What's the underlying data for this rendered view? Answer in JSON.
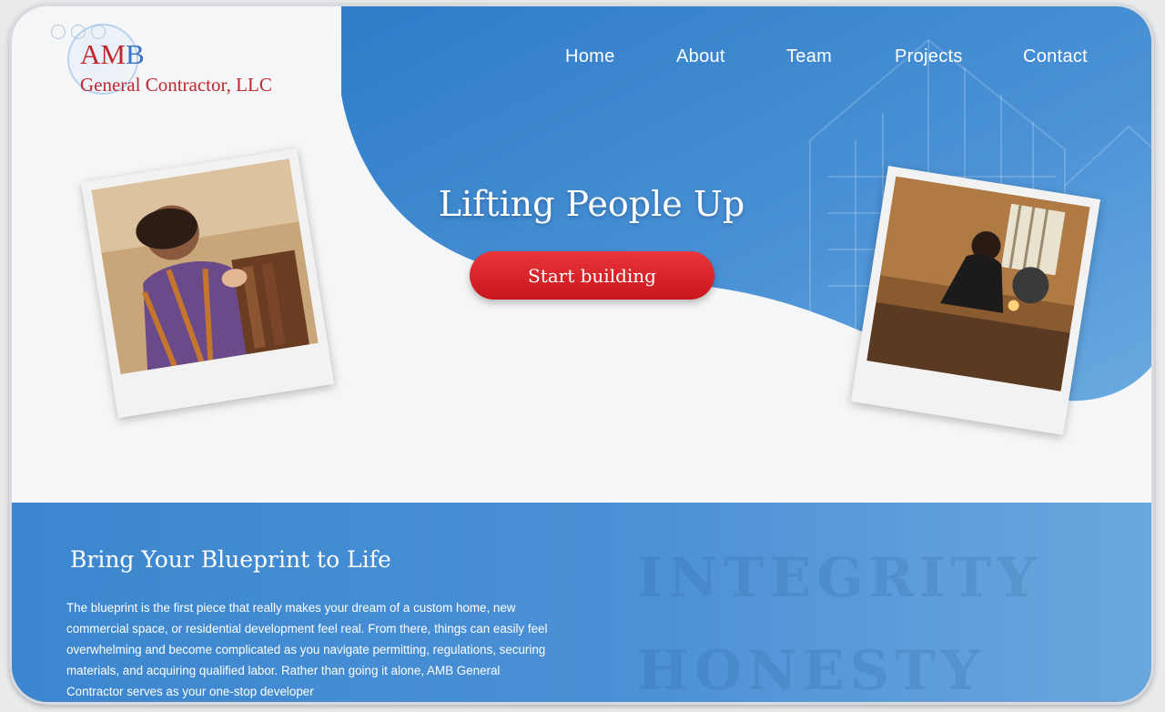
{
  "logo": {
    "mark_a": "AM",
    "mark_b": "B",
    "subtitle": "General Contractor, LLC"
  },
  "nav": {
    "items": [
      "Home",
      "About",
      "Team",
      "Projects",
      "Contact"
    ]
  },
  "hero": {
    "title": "Lifting People Up",
    "cta_label": "Start building"
  },
  "section": {
    "title": "Bring Your Blueprint to Life",
    "body": "The blueprint is the first piece that really makes your dream of a custom home, new commercial space, or residential development feel real. From there, things can easily feel overwhelming and become complicated as you navigate permitting, regulations, securing materials, and acquiring qualified labor. Rather than going it alone, AMB General Contractor serves as your one-stop developer",
    "watermark_1": "INTEGRITY",
    "watermark_2": "HONESTY"
  },
  "colors": {
    "brand_red": "#c4262e",
    "brand_blue": "#3b73c4",
    "hero_blue": "#3b86cf",
    "cta_red": "#d7252b"
  },
  "icons": [
    "logo-ring-icon"
  ]
}
